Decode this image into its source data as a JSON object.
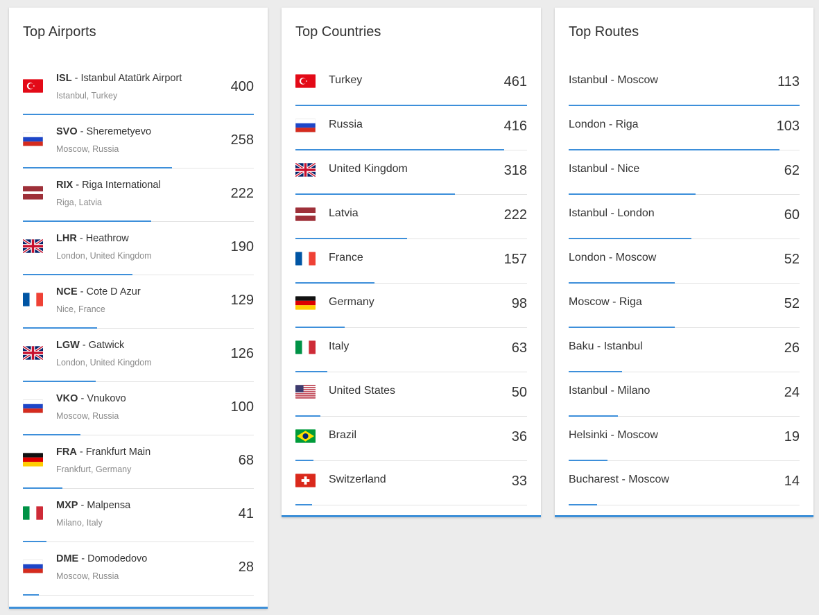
{
  "airports": {
    "title": "Top Airports",
    "items": [
      {
        "code": "ISL",
        "name": "Istanbul Atatürk Airport",
        "location": "Istanbul, Turkey",
        "count": "400",
        "flag": "turkey",
        "share": 1.0
      },
      {
        "code": "SVO",
        "name": "Sheremetyevo",
        "location": "Moscow, Russia",
        "count": "258",
        "flag": "russia",
        "share": 0.645
      },
      {
        "code": "RIX",
        "name": "Riga International",
        "location": "Riga, Latvia",
        "count": "222",
        "flag": "latvia",
        "share": 0.555
      },
      {
        "code": "LHR",
        "name": "Heathrow",
        "location": "London, United Kingdom",
        "count": "190",
        "flag": "uk",
        "share": 0.475
      },
      {
        "code": "NCE",
        "name": "Cote D Azur",
        "location": "Nice, France",
        "count": "129",
        "flag": "france",
        "share": 0.3225
      },
      {
        "code": "LGW",
        "name": "Gatwick",
        "location": "London, United Kingdom",
        "count": "126",
        "flag": "uk",
        "share": 0.315
      },
      {
        "code": "VKO",
        "name": "Vnukovo",
        "location": "Moscow, Russia",
        "count": "100",
        "flag": "russia",
        "share": 0.25
      },
      {
        "code": "FRA",
        "name": "Frankfurt Main",
        "location": "Frankfurt, Germany",
        "count": "68",
        "flag": "germany",
        "share": 0.17
      },
      {
        "code": "MXP",
        "name": "Malpensa",
        "location": "Milano, Italy",
        "count": "41",
        "flag": "italy",
        "share": 0.1025
      },
      {
        "code": "DME",
        "name": "Domodedovo",
        "location": "Moscow, Russia",
        "count": "28",
        "flag": "russia",
        "share": 0.07
      }
    ]
  },
  "countries": {
    "title": "Top Countries",
    "items": [
      {
        "name": "Turkey",
        "count": "461",
        "flag": "turkey",
        "share": 1.0
      },
      {
        "name": "Russia",
        "count": "416",
        "flag": "russia",
        "share": 0.9024
      },
      {
        "name": "United Kingdom",
        "count": "318",
        "flag": "uk",
        "share": 0.6898
      },
      {
        "name": "Latvia",
        "count": "222",
        "flag": "latvia",
        "share": 0.4816
      },
      {
        "name": "France",
        "count": "157",
        "flag": "france",
        "share": 0.3406
      },
      {
        "name": "Germany",
        "count": "98",
        "flag": "germany",
        "share": 0.2126
      },
      {
        "name": "Italy",
        "count": "63",
        "flag": "italy",
        "share": 0.1367
      },
      {
        "name": "United States",
        "count": "50",
        "flag": "usa",
        "share": 0.1085
      },
      {
        "name": "Brazil",
        "count": "36",
        "flag": "brazil",
        "share": 0.0781
      },
      {
        "name": "Switzerland",
        "count": "33",
        "flag": "switzerland",
        "share": 0.0716
      }
    ]
  },
  "routes": {
    "title": "Top Routes",
    "items": [
      {
        "name": "Istanbul - Moscow",
        "count": "113",
        "share": 1.0
      },
      {
        "name": "London - Riga",
        "count": "103",
        "share": 0.9115
      },
      {
        "name": "Istanbul - Nice",
        "count": "62",
        "share": 0.5487
      },
      {
        "name": "Istanbul - London",
        "count": "60",
        "share": 0.531
      },
      {
        "name": "London - Moscow",
        "count": "52",
        "share": 0.4602
      },
      {
        "name": "Moscow - Riga",
        "count": "52",
        "share": 0.4602
      },
      {
        "name": "Baku - Istanbul",
        "count": "26",
        "share": 0.2301
      },
      {
        "name": "Istanbul - Milano",
        "count": "24",
        "share": 0.2124
      },
      {
        "name": "Helsinki - Moscow",
        "count": "19",
        "share": 0.1681
      },
      {
        "name": "Bucharest - Moscow",
        "count": "14",
        "share": 0.1239
      }
    ]
  },
  "colors": {
    "accent": "#3d8fda",
    "background": "#ececec",
    "card": "#ffffff"
  }
}
